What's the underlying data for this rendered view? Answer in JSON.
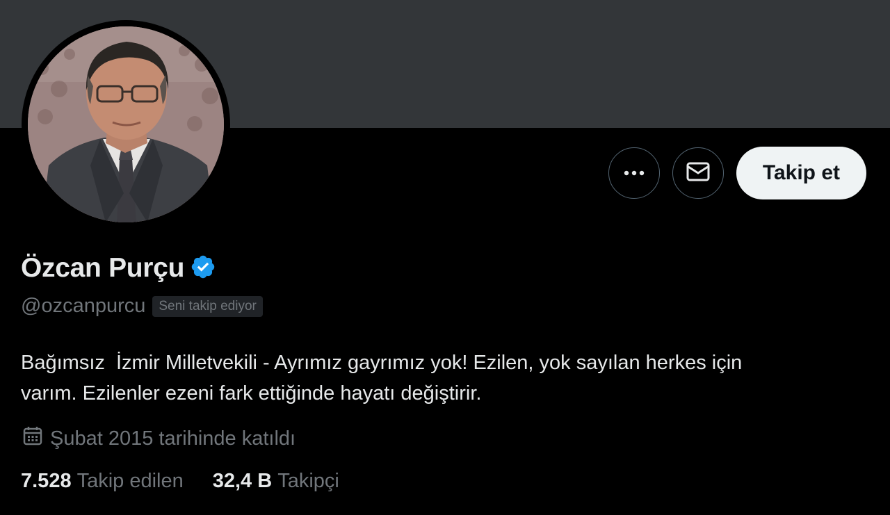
{
  "colors": {
    "banner": "#333639",
    "background": "#000000",
    "verified": "#1d9bf0",
    "secondary_text": "#71767b",
    "follow_button_bg": "#eff3f4"
  },
  "actions": {
    "more_icon": "more-icon",
    "message_icon": "envelope-icon",
    "follow_label": "Takip et"
  },
  "profile": {
    "name": "Özcan Purçu",
    "verified_icon": "verified-badge-icon",
    "handle": "@ozcanpurcu",
    "follows_you": "Seni takip ediyor",
    "bio": "Bağımsız  İzmir Milletvekili - Ayrımız gayrımız yok! Ezilen, yok sayılan herkes için\nvarım. Ezilenler ezeni fark ettiğinde hayatı değiştirir.",
    "joined": "Şubat 2015 tarihinde katıldı",
    "joined_icon": "calendar-icon"
  },
  "stats": {
    "following_count": "7.528",
    "following_label": "Takip edilen",
    "followers_count": "32,4 B",
    "followers_label": "Takipçi"
  }
}
